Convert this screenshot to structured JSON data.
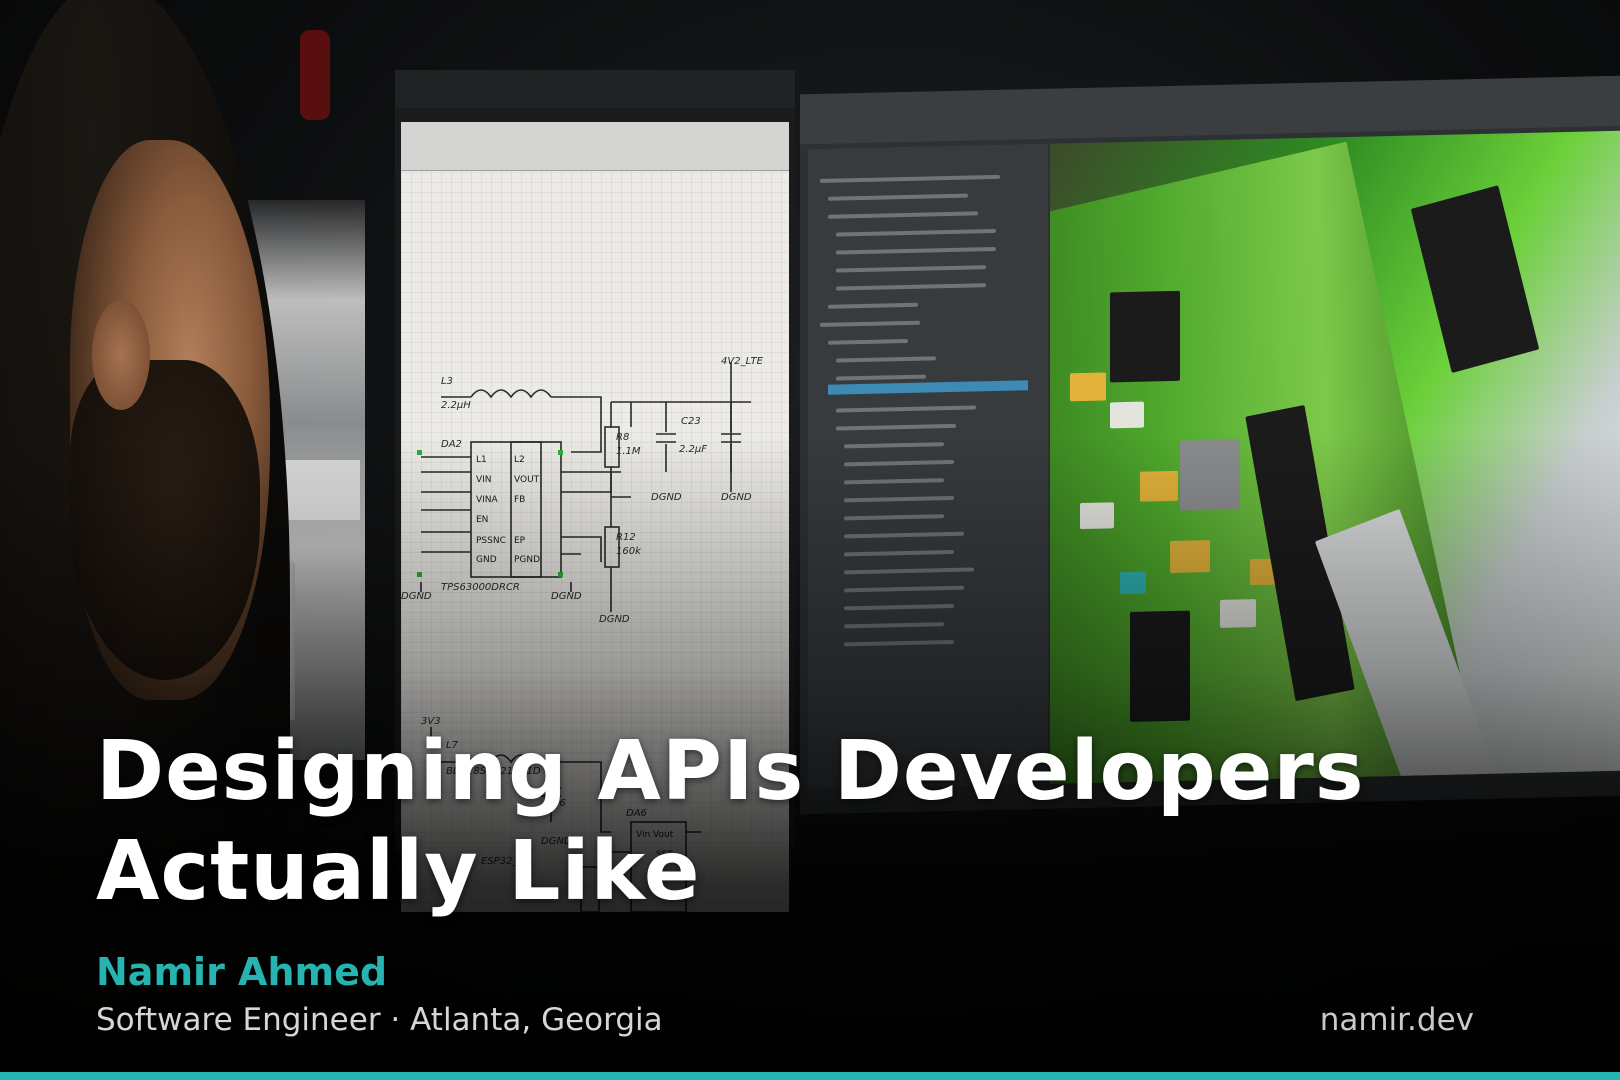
{
  "post": {
    "title_line1": "Designing APIs Developers",
    "title_line2": "Actually Like",
    "author": "Namir Ahmed",
    "subtitle": "Software Engineer · Atlanta, Georgia",
    "site": "namir.dev"
  },
  "colors": {
    "accent": "#26b3b1",
    "title": "#ffffff",
    "subtitle": "#d6d6d6"
  }
}
